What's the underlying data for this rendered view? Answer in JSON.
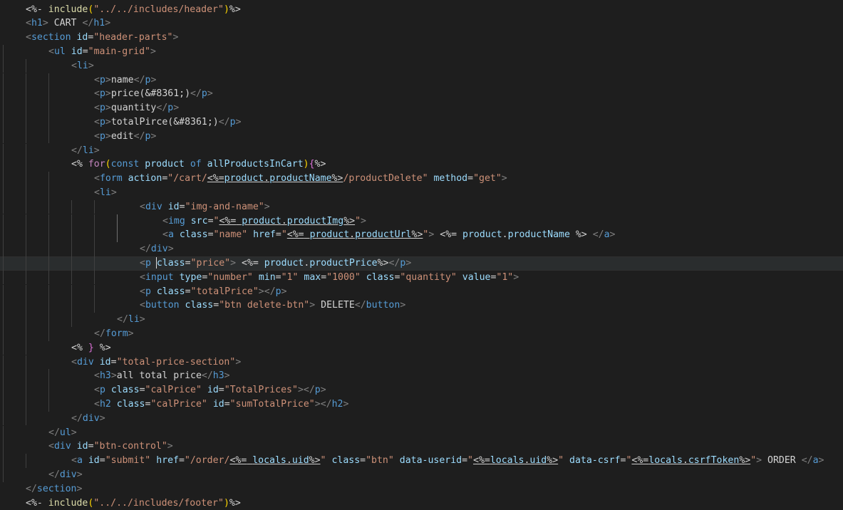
{
  "editor": {
    "language": "ejs",
    "lines": [
      {
        "text": "<%- include(\"../../includes/header\")%>"
      },
      {
        "text": "<h1> CART </h1>"
      },
      {
        "text": "<section id=\"header-parts\">"
      },
      {
        "text": "<ul id=\"main-grid\">"
      },
      {
        "text": "<li>"
      },
      {
        "text": "<p>name</p>"
      },
      {
        "text": "<p>price(&#8361;)</p>"
      },
      {
        "text": "<p>quantity</p>"
      },
      {
        "text": "<p>totalPirce(&#8361;)</p>"
      },
      {
        "text": "<p>edit</p>"
      },
      {
        "text": "</li>"
      },
      {
        "text": "<% for(const product of allProductsInCart){%>"
      },
      {
        "text": "<form action=\"/cart/<%=product.productName%>/productDelete\" method=\"get\">"
      },
      {
        "text": "<li>"
      },
      {
        "text": "<div id=\"img-and-name\">"
      },
      {
        "text": "<img src=\"<%= product.productImg%>\">"
      },
      {
        "text": "<a class=\"name\" href=\"<%= product.productUrl%>\"> <%= product.productName %> </a>"
      },
      {
        "text": "</div>"
      },
      {
        "text": "<p class=\"price\"> <%= product.productPrice%></p>"
      },
      {
        "text": "<input type=\"number\" min=\"1\" max=\"1000\" class=\"quantity\" value=\"1\">"
      },
      {
        "text": "<p class=\"totalPrice\"></p>"
      },
      {
        "text": "<button class=\"btn delete-btn\"> DELETE</button>"
      },
      {
        "text": "</li>"
      },
      {
        "text": "</form>"
      },
      {
        "text": "<% } %>"
      },
      {
        "text": "<div id=\"total-price-section\">"
      },
      {
        "text": "<h3>all total price</h3>"
      },
      {
        "text": "<p class=\"calPrice\" id=\"TotalPrices\"></p>"
      },
      {
        "text": "<h2 class=\"calPrice\" id=\"sumTotalPrice\"></h2>"
      },
      {
        "text": "</div>"
      },
      {
        "text": "</ul>"
      },
      {
        "text": "<div id=\"btn-control\">"
      },
      {
        "text": "<a id=\"submit\" href=\"/order/<%= locals.uid%>\" class=\"btn\" data-userid=\"<%=locals.uid%>\" data-csrf=\"<%=locals.csrfToken%>\"> ORDER </a>"
      },
      {
        "text": "</div>"
      },
      {
        "text": "</section>"
      },
      {
        "text": "<%- include(\"../../includes/footer\")%>"
      }
    ]
  },
  "colors": {
    "background": "#1e1e1e",
    "tag": "#569cd6",
    "attribute": "#9cdcfe",
    "string": "#ce9178",
    "text": "#d4d4d4",
    "keyword": "#c586c0",
    "bracket_yellow": "#ffd700",
    "bracket_pink": "#da70d6"
  }
}
